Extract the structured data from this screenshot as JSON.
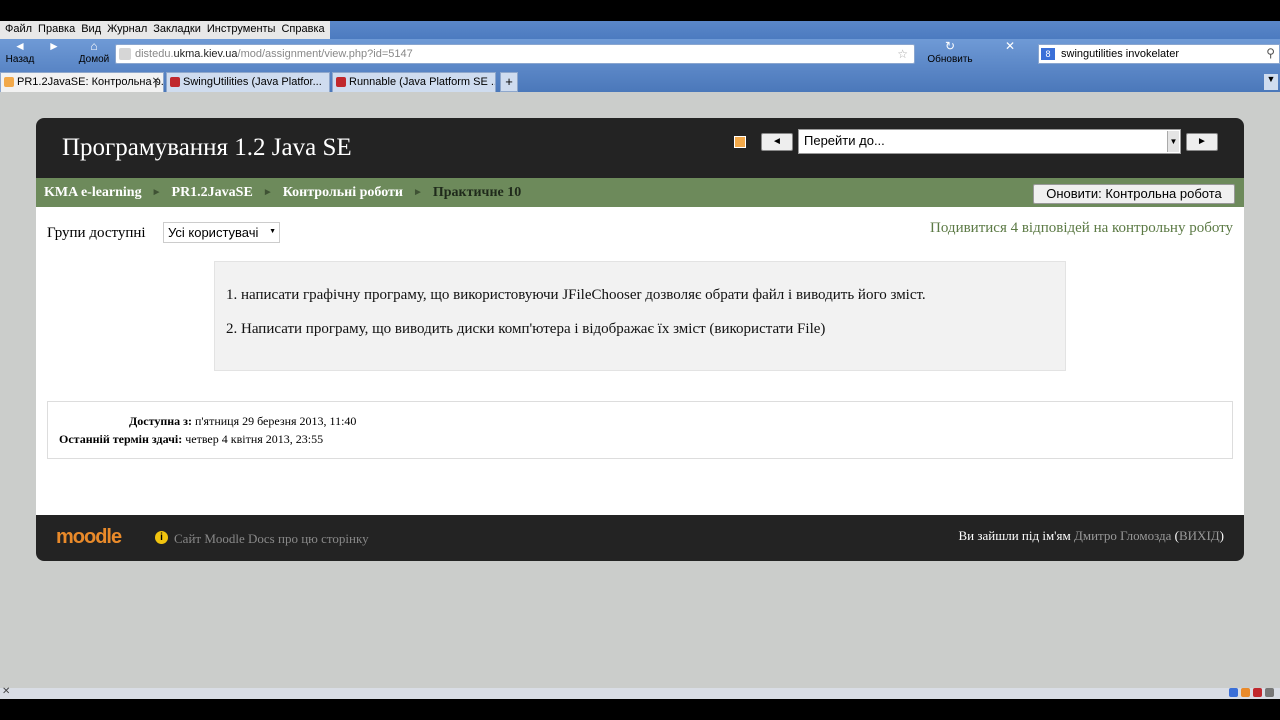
{
  "browser": {
    "menu": [
      "Файл",
      "Правка",
      "Вид",
      "Журнал",
      "Закладки",
      "Инструменты",
      "Справка"
    ],
    "nav": {
      "back_label": "Назад",
      "home_label": "Домой",
      "reload_label": "Обновить"
    },
    "url": {
      "prefix": "distedu.",
      "domain": "ukma.kiev.ua",
      "path": "/mod/assignment/view.php?id=5147"
    },
    "search": {
      "engine_icon": "g-icon",
      "value": "swingutilities invokelater"
    },
    "tabs": [
      {
        "label": "PR1.2JavaSE: Контрольна р...",
        "active": true
      },
      {
        "label": "SwingUtilities (Java Platfor...",
        "active": false
      },
      {
        "label": "Runnable (Java Platform SE ...",
        "active": false
      }
    ],
    "new_tab_label": "+"
  },
  "header": {
    "title": "Програмування 1.2 Java SE",
    "prev_label": "◄",
    "next_label": "►",
    "jump_placeholder": "Перейти до..."
  },
  "breadcrumb": {
    "items": [
      "KMA e-learning",
      "PR1.2JavaSE",
      "Контрольні роботи",
      "Практичне 10"
    ],
    "separator": "►"
  },
  "update_button": "Оновити: Контрольна робота",
  "groups": {
    "label": "Групи доступні",
    "selected": "Усі користувачі"
  },
  "view_submissions": "Подивитися 4 відповідей на контрольну роботу",
  "intro": [
    "1. написати графічну програму, що використовуючи JFileChooser дозволяє обрати файл і виводить його зміст.",
    "2. Написати програму, що виводить диски комп'ютера і відображає їх зміст (використати File)"
  ],
  "dates": {
    "available_label": "Доступна з:",
    "available_value": "п'ятниця 29 березня 2013, 11:40",
    "due_label": "Останній термін здачі:",
    "due_value": "четвер 4 квітня 2013, 23:55"
  },
  "footer": {
    "logo_main": "moodle",
    "docs_link": "Сайт Moodle Docs про цю сторінку",
    "login_prefix": "Ви зайшли під ім'ям",
    "user_name": "Дмитро Гломозда",
    "logout_open": "(",
    "logout_label": "ВИХІД",
    "logout_close": ")"
  },
  "colors": {
    "header_bg": "#232323",
    "breadcrumb_bg": "#6d8a5b",
    "link_green": "#5c7a45",
    "moodle_orange": "#e98a2a"
  }
}
